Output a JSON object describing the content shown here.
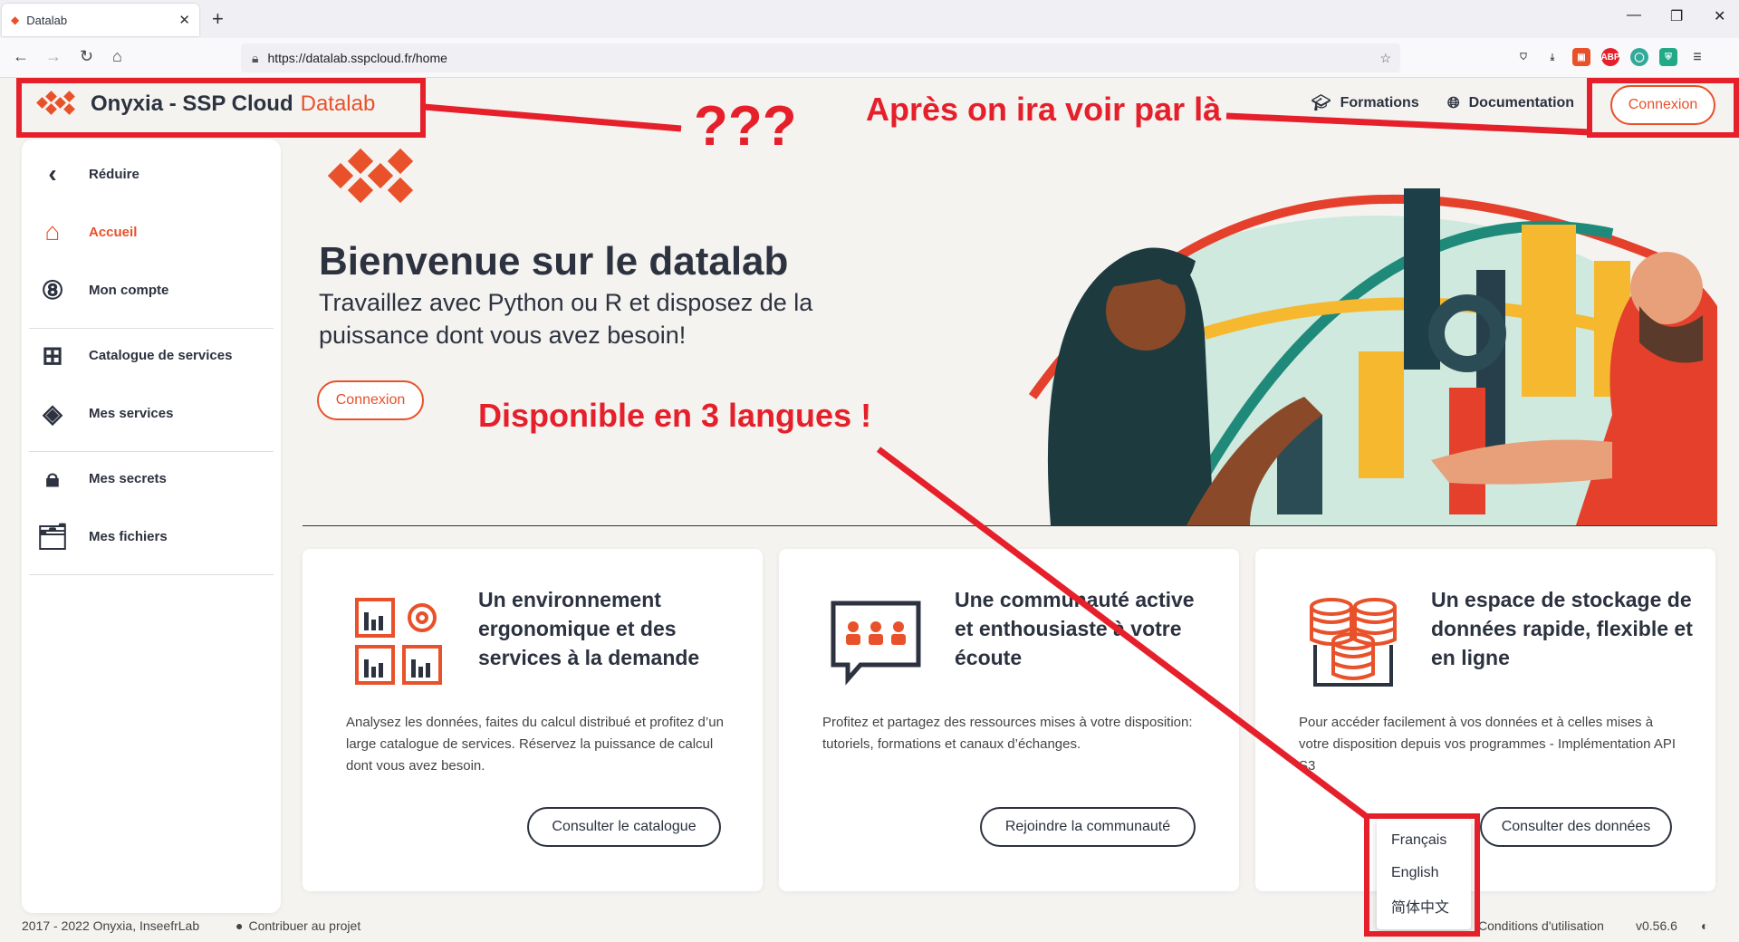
{
  "browser": {
    "tab_title": "Datalab",
    "url": "https://datalab.sspcloud.fr/home"
  },
  "header": {
    "brand_main": "Onyxia - SSP Cloud",
    "brand_accent": "Datalab",
    "nav": [
      {
        "label": "Formations",
        "icon": "graduation-cap-icon"
      },
      {
        "label": "Documentation",
        "icon": "globe-icon"
      }
    ],
    "login_label": "Connexion"
  },
  "sidebar": {
    "items": [
      {
        "label": "Réduire",
        "icon": "chevron-left-icon"
      },
      {
        "label": "Accueil",
        "icon": "home-icon",
        "active": true
      },
      {
        "label": "Mon compte",
        "icon": "account-icon"
      },
      {
        "label": "Catalogue de services",
        "icon": "grid-icon"
      },
      {
        "label": "Mes services",
        "icon": "layers-icon"
      },
      {
        "label": "Mes secrets",
        "icon": "lock-icon"
      },
      {
        "label": "Mes fichiers",
        "icon": "files-icon"
      }
    ]
  },
  "hero": {
    "title": "Bienvenue sur le datalab",
    "subtitle": "Travaillez avec Python ou R et disposez de la puissance dont vous avez besoin!",
    "button": "Connexion"
  },
  "cards": [
    {
      "title": "Un environnement ergonomique et des services à la demande",
      "description": "Analysez les données, faites du calcul distribué et profitez d’un large catalogue de services. Réservez la puissance de calcul dont vous avez besoin.",
      "button": "Consulter le catalogue",
      "icon": "services-icon"
    },
    {
      "title": "Une communauté active et enthousiaste à votre écoute",
      "description": "Profitez et partagez des ressources mises à votre disposition: tutoriels, formations et canaux d’échanges.",
      "button": "Rejoindre la communauté",
      "icon": "chat-community-icon"
    },
    {
      "title": "Un espace de stockage de données rapide, flexible et en ligne",
      "description": "Pour accéder facilement à vos données et à celles mises à votre disposition depuis vos programmes - Implémentation API S3",
      "button": "Consulter des données",
      "icon": "database-icon"
    }
  ],
  "footer": {
    "copyright": "2017 - 2022 Onyxia, InseefrLab",
    "contribute": "Contribuer au projet",
    "terms": "Conditions d'utilisation",
    "version": "v0.56.6"
  },
  "language_menu": {
    "options": [
      "Français",
      "English",
      "简体中文"
    ]
  },
  "annotations": {
    "question": "???",
    "later": "Après on ira voir par là",
    "languages": "Disponible en 3 langues !"
  },
  "colors": {
    "accent": "#e8512a",
    "annotation_red": "#e5202b",
    "text": "#2c323f"
  }
}
